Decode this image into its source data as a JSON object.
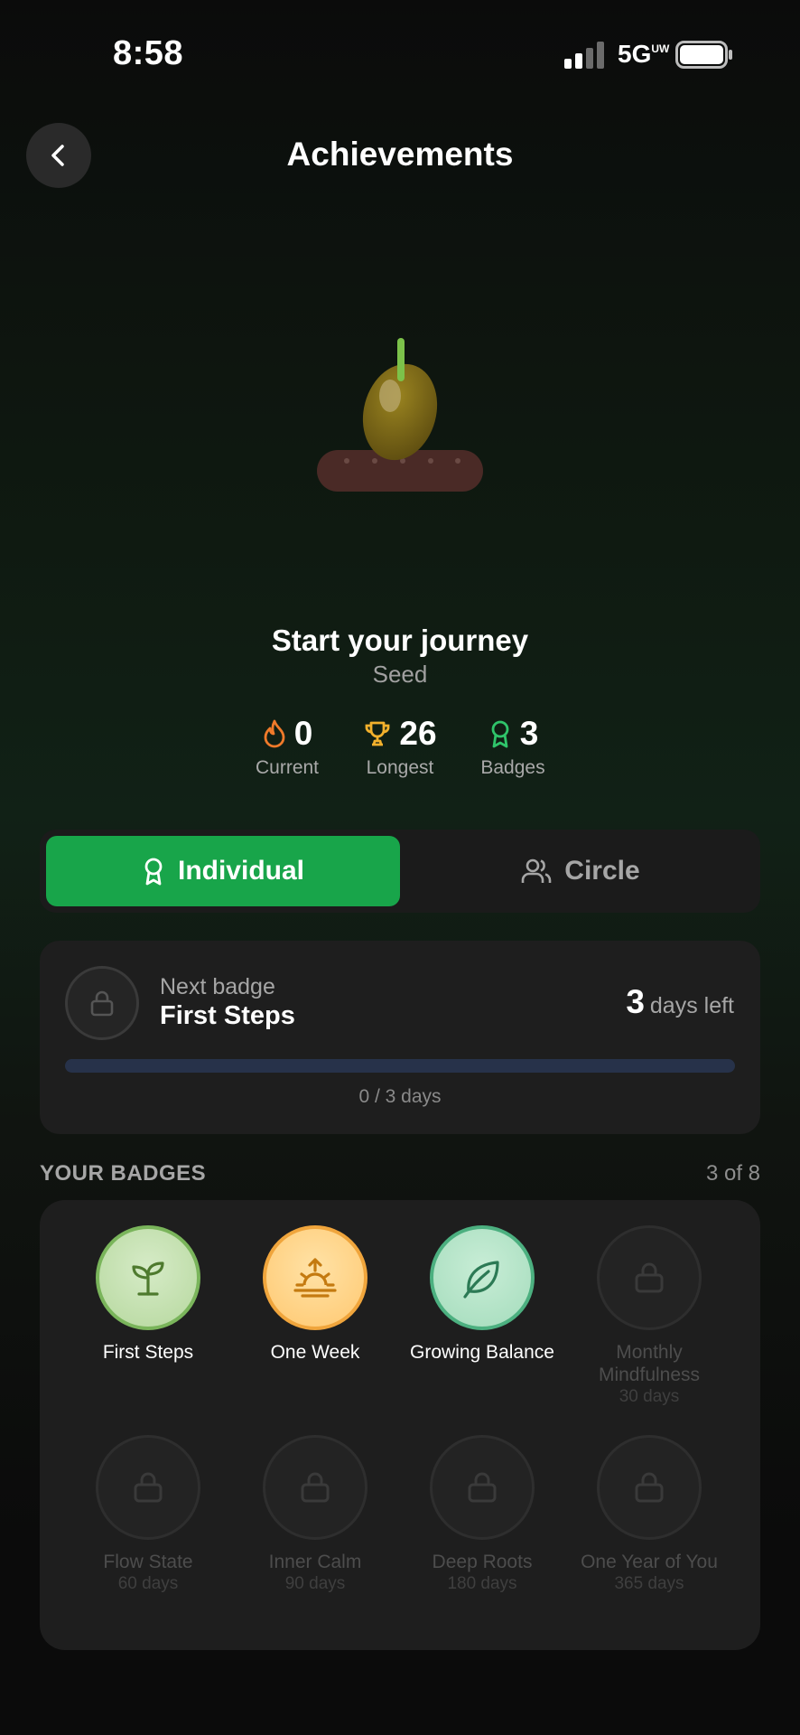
{
  "status_bar": {
    "time": "8:58",
    "network": "5G",
    "network_sup": "UW"
  },
  "header": {
    "title": "Achievements"
  },
  "journey": {
    "title": "Start your journey",
    "stage": "Seed"
  },
  "stats": [
    {
      "value": "0",
      "label": "Current",
      "icon": "flame-icon"
    },
    {
      "value": "26",
      "label": "Longest",
      "icon": "trophy-icon"
    },
    {
      "value": "3",
      "label": "Badges",
      "icon": "award-icon"
    }
  ],
  "tabs": {
    "individual": "Individual",
    "circle": "Circle",
    "selected": "Individual"
  },
  "next_badge": {
    "label": "Next badge",
    "name": "First Steps",
    "days_left_value": "3",
    "days_left_text": "days left",
    "progress_text": "0 / 3 days",
    "progress_fraction": 0
  },
  "badges_section": {
    "heading": "YOUR BADGES",
    "count": "3 of 8"
  },
  "badges": [
    {
      "name": "First Steps",
      "requirement": "",
      "earned": true,
      "icon": "sprout-icon",
      "color": "#4e7a2e"
    },
    {
      "name": "One Week",
      "requirement": "",
      "earned": true,
      "icon": "sunrise-icon",
      "color": "#c47a10"
    },
    {
      "name": "Growing Balance",
      "requirement": "",
      "earned": true,
      "icon": "leaf-icon",
      "color": "#2c7a55"
    },
    {
      "name": "Monthly Mindfulness",
      "requirement": "30 days",
      "earned": false,
      "icon": "lock-icon"
    },
    {
      "name": "Flow State",
      "requirement": "60 days",
      "earned": false,
      "icon": "lock-icon"
    },
    {
      "name": "Inner Calm",
      "requirement": "90 days",
      "earned": false,
      "icon": "lock-icon"
    },
    {
      "name": "Deep Roots",
      "requirement": "180 days",
      "earned": false,
      "icon": "lock-icon"
    },
    {
      "name": "One Year of You",
      "requirement": "365 days",
      "earned": false,
      "icon": "lock-icon"
    }
  ],
  "colors": {
    "accent": "#18a54a",
    "flame": "#f07a2a",
    "trophy": "#f2b02c",
    "award": "#2fc46a"
  }
}
